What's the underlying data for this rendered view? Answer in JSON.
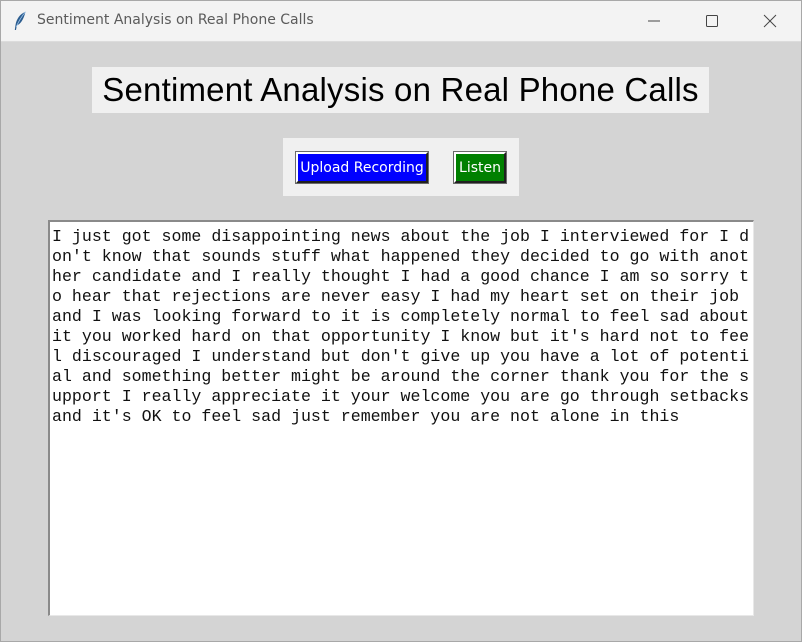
{
  "window": {
    "title": "Sentiment Analysis on Real Phone Calls",
    "app_icon": "feather-icon",
    "controls": {
      "minimize": "minimize-icon",
      "maximize": "maximize-icon",
      "close": "close-icon"
    }
  },
  "heading": "Sentiment Analysis on Real Phone Calls",
  "buttons": {
    "upload_label": "Upload Recording",
    "listen_label": "Listen",
    "upload_color": "#0000ff",
    "listen_color": "#008000"
  },
  "transcript": {
    "text": "I just got some disappointing news about the job I interviewed for I don't know that sounds stuff what happened they decided to go with another candidate and I really thought I had a good chance I am so sorry to hear that rejections are never easy I had my heart set on their job and I was looking forward to it is completely normal to feel sad about it you worked hard on that opportunity I know but it's hard not to feel discouraged I understand but don't give up you have a lot of potential and something better might be around the corner thank you for the support I really appreciate it your welcome you are go through setbacks and it's OK to feel sad just remember you are not alone in this"
  }
}
